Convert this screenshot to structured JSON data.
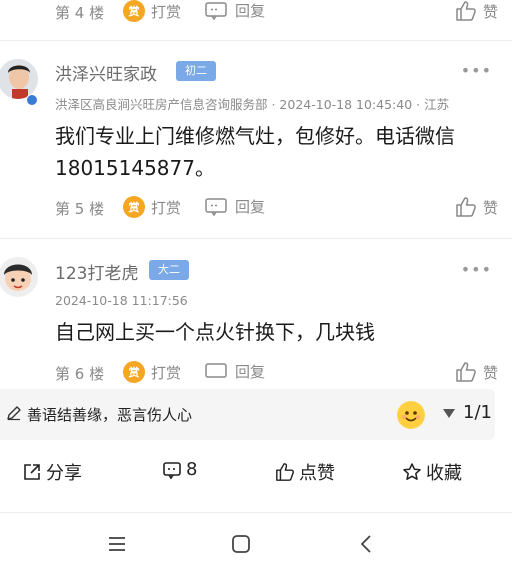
{
  "prev_post": {
    "floor": "第 4 楼",
    "reward_label": "打赏",
    "reply_label": "回复",
    "like_label": "赞"
  },
  "posts": [
    {
      "username": "洪泽兴旺家政",
      "level": "初二",
      "meta": "洪泽区高良涧兴旺房产信息咨询服务部 · 2024-10-18 10:45:40 · 江苏",
      "content": "我们专业上门维修燃气灶，包修好。电话微信18015145877。",
      "floor": "第 5 楼",
      "reward_label": "打赏",
      "reply_label": "回复",
      "like_label": "赞"
    },
    {
      "username": "123打老虎",
      "level": "大二",
      "meta": "2024-10-18 11:17:56",
      "content": "自己网上买一个点火针换下，几块钱",
      "floor": "第 6 楼",
      "reward_label": "打赏",
      "reply_label": "回复",
      "like_label": "赞"
    }
  ],
  "coin_glyph": "赏",
  "more_glyph": "•••",
  "input_bar": {
    "placeholder": "善语结善缘，恶言伤人心",
    "page": "1/1"
  },
  "bottom_bar": {
    "share": "分享",
    "comments": "8",
    "like": "点赞",
    "favorite": "收藏"
  },
  "colors": {
    "badge": "#7ba8e6",
    "coin": "#f5a623",
    "separator": "#ececec"
  }
}
